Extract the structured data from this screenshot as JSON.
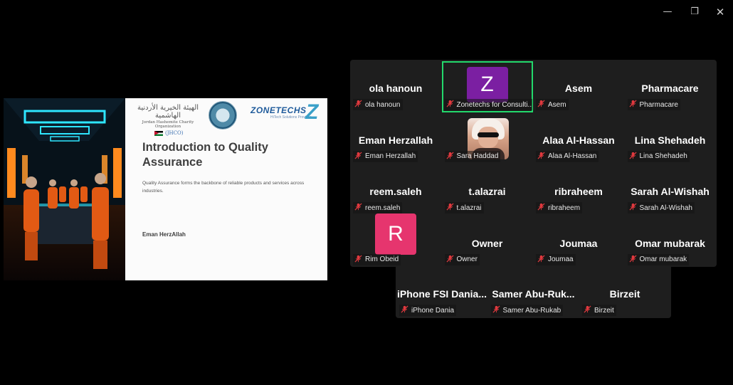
{
  "window": {
    "minimize_icon": "minimize-icon",
    "restore_icon": "restore-icon",
    "close_icon": "close-icon"
  },
  "slide": {
    "arabic_org": "الهيئة الخيرية الأردنية الهاشمية",
    "org_name_en": "Jordan Hashemite Charity Organization",
    "org_abbr": "(JHCO)",
    "brand": "ZONETECHS",
    "brand_tagline": "HiTech Solutions Provider",
    "title": "Introduction to Quality Assurance",
    "body": "Quality Assurance forms the backbone of reliable products and services across industries.",
    "author": "Eman HerzAllah"
  },
  "colors": {
    "active_speaker": "#23d96c",
    "muted_mic": "#e0393e",
    "tile_bg": "#1e1e1e",
    "avatar_z": "#7b1fa2",
    "avatar_r": "#e6356e"
  },
  "participants": [
    {
      "display": "ola hanoun",
      "label": "ola hanoun"
    },
    {
      "display": "Z",
      "label": "Zonetechs for Consulti...",
      "active": true
    },
    {
      "display": "Asem",
      "label": "Asem"
    },
    {
      "display": "Pharmacare",
      "label": "Pharmacare"
    },
    {
      "display": "Eman Herzallah",
      "label": "Eman Herzallah"
    },
    {
      "display": "",
      "label": "Sara Haddad"
    },
    {
      "display": "Alaa Al-Hassan",
      "label": "Alaa Al-Hassan"
    },
    {
      "display": "Lina Shehadeh",
      "label": "Lina Shehadeh"
    },
    {
      "display": "reem.saleh",
      "label": "reem.saleh"
    },
    {
      "display": "t.alazrai",
      "label": "t.alazrai"
    },
    {
      "display": "ribraheem",
      "label": "ribraheem"
    },
    {
      "display": "Sarah Al-Wishah",
      "label": "Sarah Al-Wishah"
    },
    {
      "display": "R",
      "label": "Rim Obeid"
    },
    {
      "display": "Owner",
      "label": "Owner"
    },
    {
      "display": "Joumaa",
      "label": "Joumaa"
    },
    {
      "display": "Omar mubarak",
      "label": "Omar mubarak"
    },
    {
      "display": "iPhone FSI Dania...",
      "label": "iPhone Dania"
    },
    {
      "display": "Samer Abu-Ruk...",
      "label": "Samer Abu-Rukab"
    },
    {
      "display": "Birzeit",
      "label": "Birzeit"
    }
  ]
}
